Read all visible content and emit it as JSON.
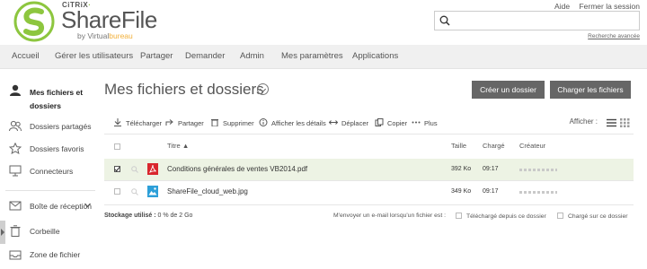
{
  "brand": {
    "citrix": "CiTRiX",
    "name": "ShareFile",
    "by": "by Virtual",
    "by_accent": "bureau",
    "colors": {
      "green": "#8dc63f",
      "accent": "#f2b03a",
      "pdf": "#d9262e",
      "image": "#2d9fd8"
    }
  },
  "header": {
    "help": "Aide",
    "logout": "Fermer la session",
    "search_placeholder": "",
    "advanced_search": "Recherche avancée"
  },
  "nav": [
    "Accueil",
    "Gérer les utilisateurs",
    "Partager",
    "Demander",
    "Admin",
    "Mes paramètres",
    "Applications"
  ],
  "sidebar": {
    "items": [
      {
        "label": "Mes fichiers et dossiers",
        "icon": "person-icon"
      },
      {
        "label": "Dossiers partagés",
        "icon": "people-icon"
      },
      {
        "label": "Dossiers favoris",
        "icon": "star-icon"
      },
      {
        "label": "Connecteurs",
        "icon": "monitor-icon"
      },
      {
        "label": "Boîte de réception",
        "icon": "envelope-icon"
      },
      {
        "label": "Corbeille",
        "icon": "trash-icon"
      },
      {
        "label": "Zone de fichier",
        "icon": "inbox-icon"
      }
    ]
  },
  "main": {
    "title": "Mes fichiers et dossiers",
    "create_folder": "Créer un dossier",
    "upload_files": "Charger les fichiers"
  },
  "toolbar": {
    "download": "Télécharger",
    "share": "Partager",
    "delete": "Supprimer",
    "details": "Afficher les détails",
    "move": "Déplacer",
    "copy": "Copier",
    "more": "Plus",
    "view_label": "Afficher :"
  },
  "table": {
    "columns": {
      "title": "Titre",
      "size": "Taille",
      "uploaded": "Chargé",
      "creator": "Créateur"
    },
    "rows": [
      {
        "name": "Conditions générales de ventes VB2014.pdf",
        "size": "392 Ko",
        "time": "09:17",
        "type": "pdf",
        "selected": true
      },
      {
        "name": "ShareFile_cloud_web.jpg",
        "size": "349 Ko",
        "time": "09:17",
        "type": "image",
        "selected": false
      }
    ]
  },
  "footer": {
    "storage_label": "Stockage utilisé :",
    "storage_value": "0 % de 2 Go",
    "notify": "M'envoyer un e-mail lorsqu'un fichier est :",
    "downloaded": "Téléchargé depuis ce dossier",
    "uploaded": "Chargé sur ce dossier"
  }
}
